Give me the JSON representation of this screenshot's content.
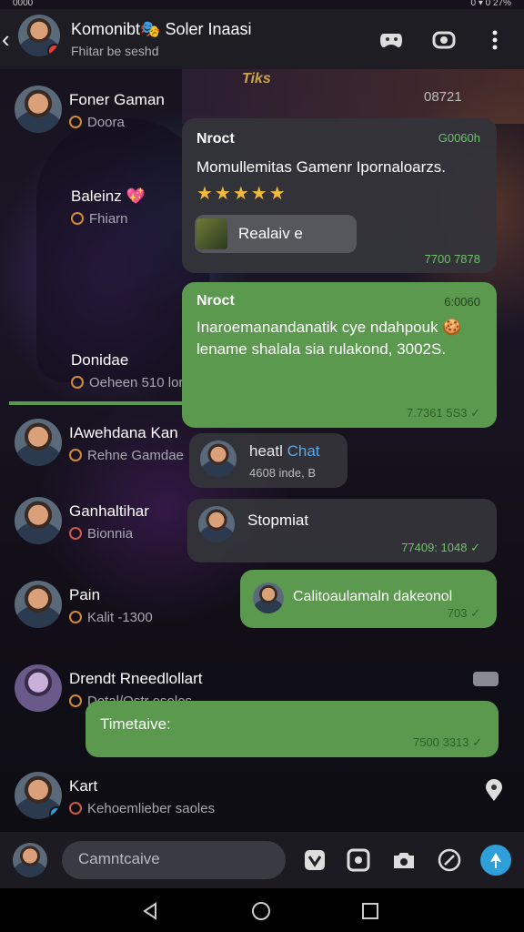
{
  "status_bar": {
    "time": "0000",
    "right": "0 ▾ 0 27%"
  },
  "header": {
    "title": "Komonibt🎭 Soler Inaasi",
    "subtitle": "Fhitar be seshd"
  },
  "banner_text": "Tiks",
  "corner_count": "08721",
  "contacts": [
    {
      "name": "Foner Gaman",
      "sub": "Doora"
    },
    {
      "name": "Baleinz 💖",
      "sub": "Fhiarn"
    },
    {
      "name": "Donidae",
      "sub": "Oeheen 510 lor"
    },
    {
      "name": "IAwehdana Kan",
      "sub": "Rehne Gamdae"
    },
    {
      "name": "Ganhaltihar",
      "sub": "Bionnia"
    },
    {
      "name": "Pain",
      "sub": "Kalit -1300"
    },
    {
      "name": "Drendt Rneedlollart",
      "sub": "Dotal/Ostr esolos"
    },
    {
      "name": "Kart",
      "sub": "Kehoemlieber saoles"
    }
  ],
  "messages": [
    {
      "sender": "Nroct",
      "corner": "G0060h",
      "text": "Momullemitas Gamenr Ipornaloarzs.",
      "stars": "★★★★★",
      "attachment": "Realaiv e",
      "meta": "7700 7878"
    },
    {
      "sender": "Nroct",
      "corner": "6:0060",
      "text": "Inaroemanandanatik cye ndahpouk 🍪 lename shalala sia rulakond, 3002S.",
      "meta": "7.7361 5S3 ✓"
    },
    {
      "text_a": "heatl",
      "text_b": "Chat",
      "sub": "4608 inde, B"
    },
    {
      "text": "Stopmiat",
      "meta": "77409: 1048 ✓"
    },
    {
      "text": "Calitoaulamaln dakeonol",
      "meta": "703 ✓"
    },
    {
      "text": "Timetaive:",
      "meta": "7500 3313 ✓"
    }
  ],
  "input": {
    "placeholder": "Camntcaive"
  }
}
